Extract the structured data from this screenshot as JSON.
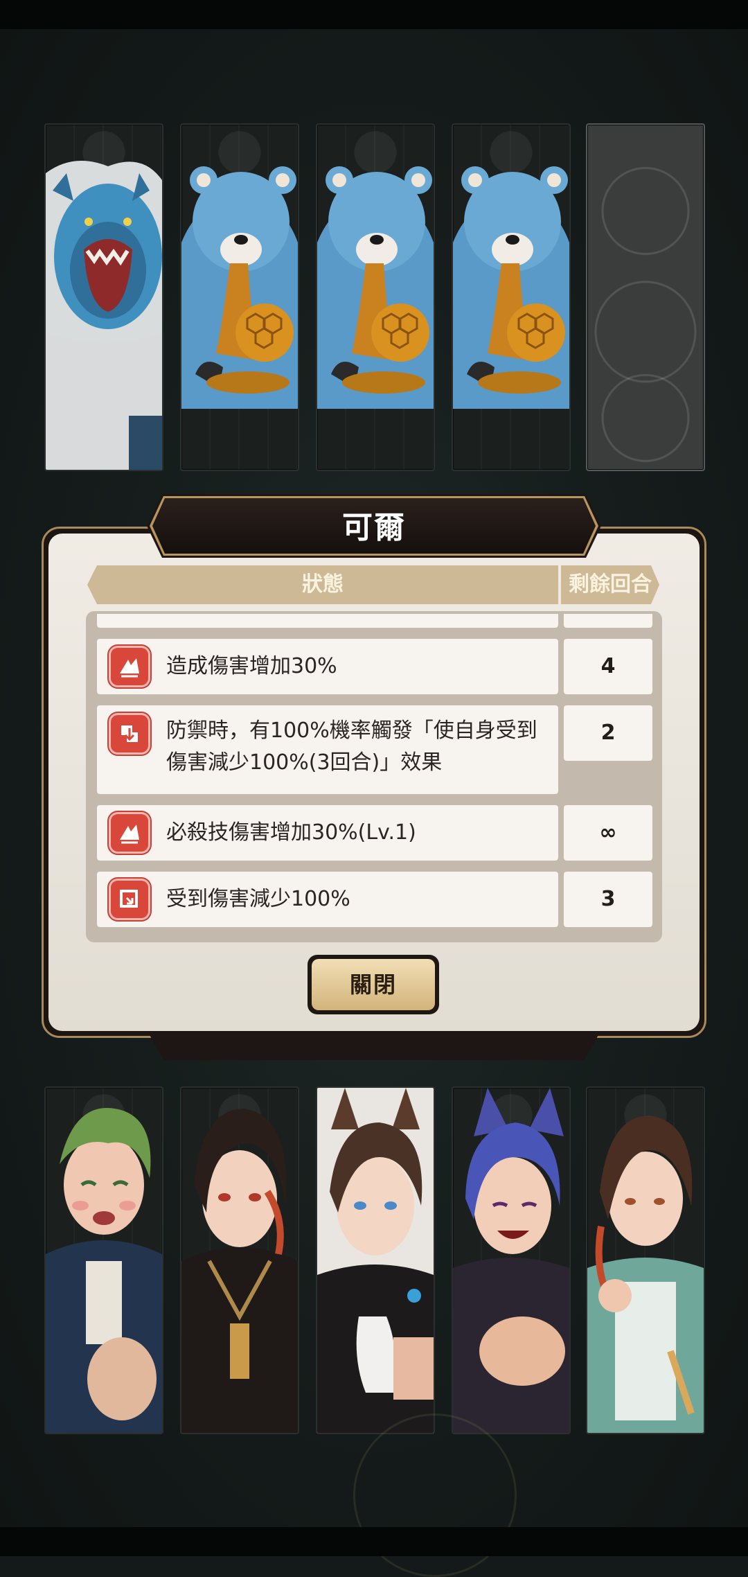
{
  "dialog": {
    "title": "可爾",
    "headers": {
      "status": "狀態",
      "turns": "剩餘回合"
    },
    "rows": [
      {
        "icon": "attack-up-icon",
        "text": "造成傷害增加30%",
        "turns": "4"
      },
      {
        "icon": "defense-trigger-icon",
        "text": "防禦時，有100%機率觸發「使自身受到傷害減少100%(3回合)」效果",
        "turns": "2"
      },
      {
        "icon": "attack-up-icon",
        "text": "必殺技傷害增加30%(Lv.1)",
        "turns": "∞"
      },
      {
        "icon": "damage-reduction-icon",
        "text": "受到傷害減少100%",
        "turns": "3"
      }
    ],
    "close_label": "關閉"
  },
  "enemies": [
    {
      "name": "roaring-blue-bear"
    },
    {
      "name": "blue-bear-honeycomb"
    },
    {
      "name": "blue-bear-honeycomb"
    },
    {
      "name": "blue-bear-honeycomb"
    },
    {
      "name": "empty-slot"
    }
  ],
  "allies": [
    {
      "name": "green-hair-character"
    },
    {
      "name": "dark-hair-red-eye-character"
    },
    {
      "name": "wolf-ear-character"
    },
    {
      "name": "purple-hair-cat-ear-character"
    },
    {
      "name": "brown-hair-teal-coat-character"
    }
  ],
  "colors": {
    "background": "#141a19",
    "panel": "#ece7de",
    "gold": "#b6955e",
    "buff_icon": "#d9463a"
  }
}
